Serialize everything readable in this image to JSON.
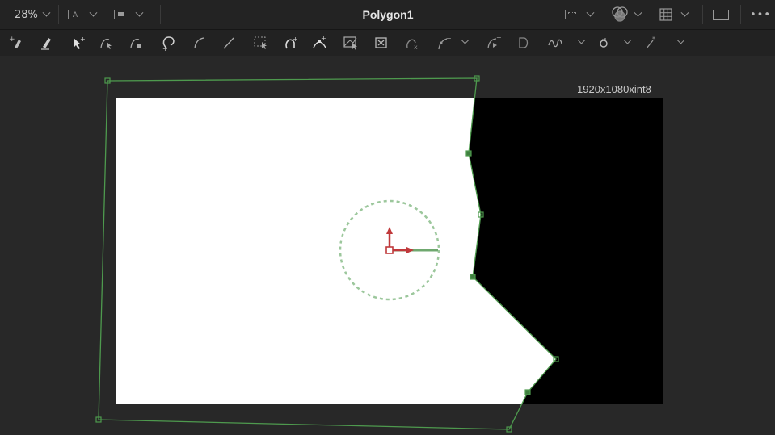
{
  "header": {
    "zoom_label": "28%",
    "channel_label": "A",
    "title": "Polygon1",
    "more_label": "•••"
  },
  "viewer": {
    "resolution_label": "1920x1080xint8",
    "canvas_colors": {
      "white": "#ffffff",
      "black": "#000000",
      "spline": "#5fae5f",
      "transform": "#c0393b"
    }
  },
  "toolbar": {
    "tools": [
      "add-point-icon",
      "pencil-icon",
      "select-icon",
      "smooth-icon",
      "linear-icon",
      "close-shape-icon",
      "curve-icon",
      "line-icon",
      "select-region-icon",
      "undo-curve-icon",
      "bezier-icon",
      "node-select-icon",
      "delete-node-icon",
      "reshape-icon",
      "insert-point-icon",
      "publish-icon",
      "keyframe-icon",
      "invert-icon",
      "magic-wand-icon"
    ]
  }
}
